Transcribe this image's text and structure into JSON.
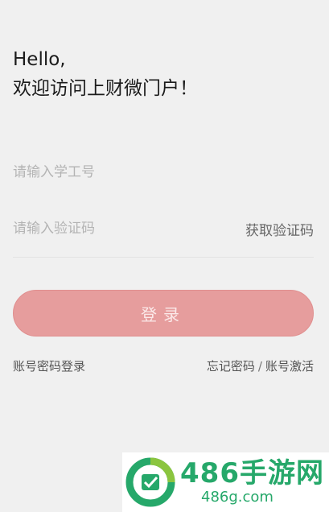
{
  "greeting": {
    "line1": "Hello,",
    "line2": "欢迎访问上财微门户！"
  },
  "form": {
    "student_id_placeholder": "请输入学工号",
    "code_placeholder": "请输入验证码",
    "get_code_label": "获取验证码",
    "login_label": "登录"
  },
  "links": {
    "password_login": "账号密码登录",
    "forgot_password": "忘记密码",
    "separator": "/",
    "activate_account": "账号激活"
  },
  "watermark": {
    "brand": "486手游网",
    "url": "486g.com"
  },
  "colors": {
    "background": "#f0f0f0",
    "login_button": "#e69d9d",
    "watermark_green": "#26a86a"
  }
}
